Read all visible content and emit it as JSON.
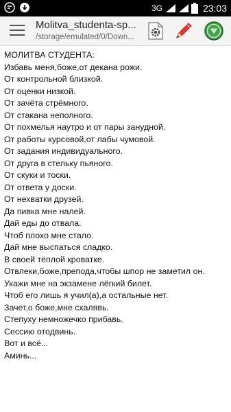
{
  "status_bar": {
    "network": "3G",
    "network_sup": "3G",
    "time": "23:03"
  },
  "app_bar": {
    "title": "Molitva_studenta-sp...",
    "subtitle": "/storage/emulated/0/Down..."
  },
  "icons": {
    "menu": "menu-icon",
    "settings": "gear-icon",
    "edit": "pencil-icon",
    "action": "green-down-arrow-icon"
  },
  "colors": {
    "status_bar_bg": "#000000",
    "toolbar_bg": "#f4f4f4",
    "pencil_red": "#e53935",
    "action_green": "#43a047"
  },
  "document": {
    "lines": [
      "МОЛИТВА СТУДЕНТА:",
      "Избавь меня,боже,от декана рожи.",
      "От контрольной близкой.",
      "От оценки низкой.",
      "От зачёта стрёмного.",
      "От стакана неполного.",
      "От похмелья наутро и от пары занудной.",
      "От работы курсовой,от лабы чумовой.",
      "От задания индивидуального.",
      "От друга в стельку пьяного.",
      "От скуки и тоски.",
      "От ответа у доски.",
      "От нехватки друзей.",
      "Да пивка мне налей.",
      "Дай еды до отвала.",
      "Чтоб плохо мне стало.",
      "Дай мне выспаться сладко.",
      "В своей тёплой кроватке.",
      "Отвлеки,боже,препода,чтобы шпор не заметил он.",
      "Укажи мне на экзамене лёгкий билет.",
      "Чтоб его лишь я учил(а),а остальные нет.",
      "Зачет,о боже,мне схалявь.",
      "Степуху немножечко прибавь.",
      "Сессию отодвинь.",
      "Вот и всё...",
      "Аминь..."
    ]
  }
}
